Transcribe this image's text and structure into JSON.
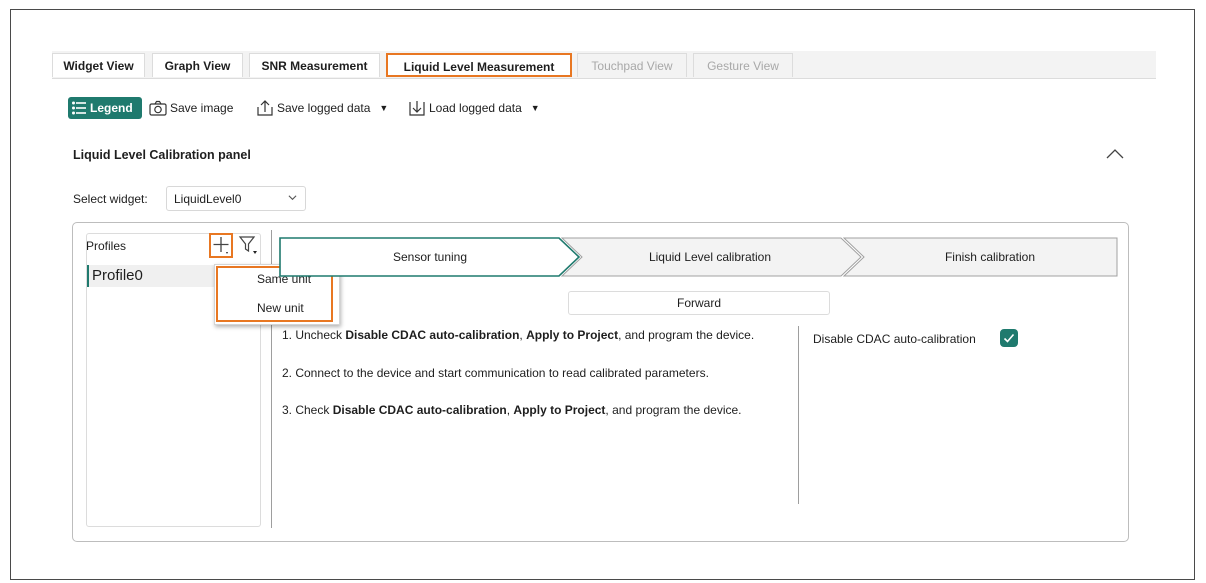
{
  "tabs": [
    {
      "label": "Widget View",
      "state": "normal"
    },
    {
      "label": "Graph View",
      "state": "normal"
    },
    {
      "label": "SNR Measurement",
      "state": "normal"
    },
    {
      "label": "Liquid Level Measurement",
      "state": "active"
    },
    {
      "label": "Touchpad View",
      "state": "disabled"
    },
    {
      "label": "Gesture View",
      "state": "disabled"
    }
  ],
  "toolbar": {
    "legend": "Legend",
    "save_image": "Save image",
    "save_logged": "Save logged data",
    "load_logged": "Load logged data"
  },
  "panel": {
    "title": "Liquid Level Calibration panel",
    "select_label": "Select widget:",
    "select_value": "LiquidLevel0"
  },
  "profiles": {
    "label": "Profiles",
    "items": [
      "Profile0"
    ],
    "menu": [
      "Same unit",
      "New unit"
    ]
  },
  "steps": [
    "Sensor tuning",
    "Liquid Level calibration",
    "Finish calibration"
  ],
  "forward_label": "Forward",
  "instructions": [
    {
      "pre": "1. Uncheck ",
      "b1": "Disable CDAC auto-calibration",
      "mid": ", ",
      "b2": "Apply to Project",
      "post": ", and program the device."
    },
    {
      "text": "2. Connect to the device and start communication to read calibrated parameters."
    },
    {
      "pre": "3. Check ",
      "b1": "Disable CDAC auto-calibration",
      "mid": ", ",
      "b2": "Apply to Project",
      "post": ", and program the device."
    }
  ],
  "cdac_label": "Disable CDAC auto-calibration",
  "cdac_checked": true,
  "colors": {
    "accent": "#1f7a6e",
    "highlight": "#e87722"
  }
}
